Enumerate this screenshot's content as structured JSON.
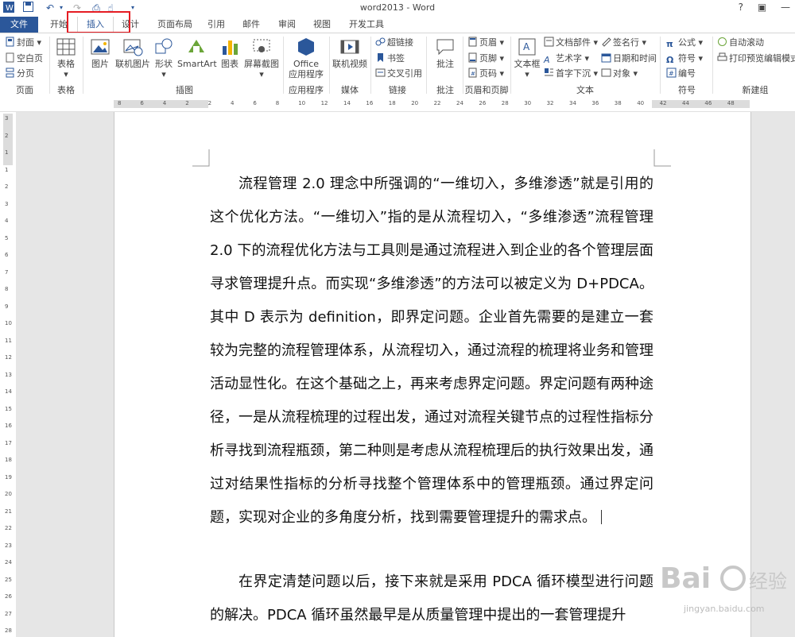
{
  "window": {
    "title": "word2013 - Word",
    "help": "?"
  },
  "tabs": [
    {
      "label": "文件",
      "active": false
    },
    {
      "label": "开始",
      "active": false
    },
    {
      "label": "插入",
      "active": true
    },
    {
      "label": "设计",
      "active": false
    },
    {
      "label": "页面布局",
      "active": false
    },
    {
      "label": "引用",
      "active": false
    },
    {
      "label": "邮件",
      "active": false
    },
    {
      "label": "审阅",
      "active": false
    },
    {
      "label": "视图",
      "active": false
    },
    {
      "label": "开发工具",
      "active": false
    }
  ],
  "ribbon": {
    "pages": {
      "label": "页面",
      "cover": "封面",
      "blank": "空白页",
      "break": "分页"
    },
    "tables": {
      "label": "表格",
      "table": "表格"
    },
    "illustrations": {
      "label": "插图",
      "picture": "图片",
      "online_picture": "联机图片",
      "shapes": "形状",
      "smartart": "SmartArt",
      "chart": "图表",
      "screenshot": "屏幕截图"
    },
    "apps": {
      "label": "应用程序",
      "office_line1": "Office",
      "office_line2": "应用程序"
    },
    "media": {
      "label": "媒体",
      "online_video": "联机视频"
    },
    "links": {
      "label": "链接",
      "hyperlink": "超链接",
      "bookmark": "书签",
      "cross_ref": "交叉引用"
    },
    "comments": {
      "label": "批注",
      "comment": "批注"
    },
    "header_footer": {
      "label": "页眉和页脚",
      "header": "页眉",
      "footer": "页脚",
      "page_number": "页码"
    },
    "text": {
      "label": "文本",
      "textbox": "文本框",
      "quick_parts": "文档部件",
      "wordart": "艺术字",
      "dropcap": "首字下沉",
      "signature": "签名行",
      "datetime": "日期和时间",
      "object": "对象"
    },
    "symbols": {
      "label": "符号",
      "equation": "公式",
      "symbol": "符号",
      "number": "编号"
    },
    "new_group": {
      "label": "新建组",
      "autoscroll": "自动滚动",
      "print_preview": "打印预览编辑模式"
    }
  },
  "document": {
    "paragraph1": "流程管理 2.0 理念中所强调的“一维切入，多维渗透”就是引用的这个优化方法。“一维切入”指的是从流程切入，“多维渗透”流程管理 2.0 下的流程优化方法与工具则是通过流程进入到企业的各个管理层面寻求管理提升点。而实现“多维渗透”的方法可以被定义为 D+PDCA。其中 D 表示为 definition，即界定问题。企业首先需要的是建立一套较为完整的流程管理体系，从流程切入，通过流程的梳理将业务和管理活动显性化。在这个基础之上，再来考虑界定问题。界定问题有两种途径，一是从流程梳理的过程出发，通过对流程关键节点的过程性指标分析寻找到流程瓶颈，第二种则是考虑从流程梳理后的执行效果出发，通过对结果性指标的分析寻找整个管理体系中的管理瓶颈。通过界定问题，实现对企业的多角度分析，找到需要管理提升的需求点。",
    "paragraph2": "在界定清楚问题以后，接下来就是采用 PDCA 循环模型进行问题的解决。PDCA 循环虽然最早是从质量管理中提出的一套管理提升"
  },
  "watermark": {
    "brand": "Bai",
    "brand_cn": "经验",
    "url": "jingyan.baidu.com"
  },
  "ruler": {
    "horizontal_ticks": [
      "8",
      "6",
      "4",
      "2",
      "2",
      "4",
      "6",
      "8",
      "10",
      "12",
      "14",
      "16",
      "18",
      "20",
      "22",
      "24",
      "26",
      "28",
      "30",
      "32",
      "34",
      "36",
      "38",
      "40",
      "42",
      "44",
      "46",
      "48"
    ],
    "vertical_ticks": [
      "3",
      "2",
      "1",
      "1",
      "2",
      "3",
      "4",
      "5",
      "6",
      "7",
      "8",
      "9",
      "10",
      "11",
      "12",
      "13",
      "14",
      "15",
      "16",
      "17",
      "18",
      "19",
      "20",
      "21",
      "22",
      "23",
      "24",
      "25",
      "26",
      "27",
      "28"
    ]
  },
  "colors": {
    "accent": "#2b579a",
    "highlight_frame": "#e51c23"
  }
}
